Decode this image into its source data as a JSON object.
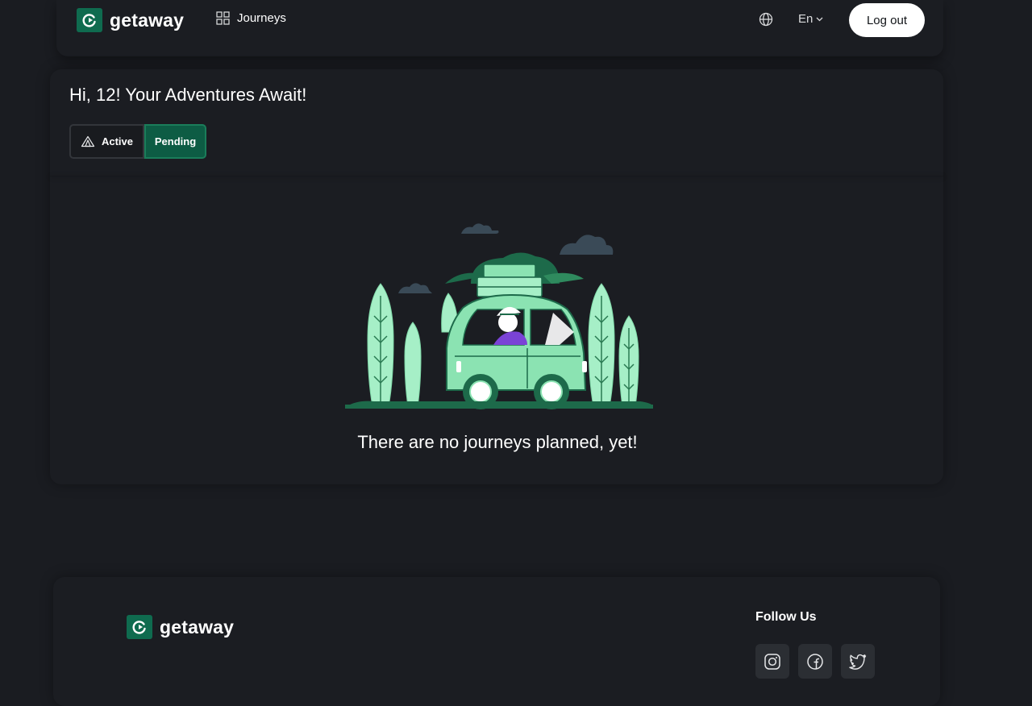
{
  "header": {
    "brand_name": "getaway",
    "nav_journeys": "Journeys",
    "language": "En",
    "logout_label": "Log out"
  },
  "main": {
    "greeting": "Hi, 12! Your Adventures Await!",
    "tabs": [
      {
        "label": "Active",
        "icon": "tent-icon",
        "selected": false
      },
      {
        "label": "Pending",
        "selected": true
      }
    ],
    "empty_message": "There are no journeys planned, yet!"
  },
  "footer": {
    "brand_name": "getaway",
    "follow_title": "Follow Us",
    "socials": [
      "instagram-icon",
      "facebook-icon",
      "twitter-icon"
    ]
  },
  "colors": {
    "background": "#1a1c21",
    "panel": "#1b1d22",
    "brand_green": "#0f6b4f",
    "pending_tab": "#0d5c44",
    "illustration_green": "#8be3b2"
  }
}
